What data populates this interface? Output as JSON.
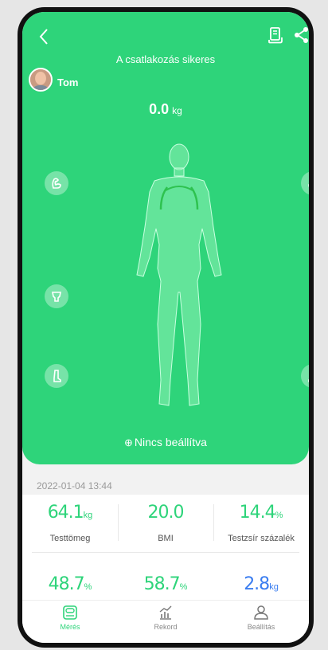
{
  "header": {
    "status": "A csatlakozás sikeres"
  },
  "user": {
    "name": "Tom"
  },
  "weight": {
    "value": "0.0",
    "unit": "kg"
  },
  "not_set_label": "Nincs beállítva",
  "date": "2022-01-04 13:44",
  "metrics": [
    {
      "value": "64.1",
      "unit": "kg",
      "label": "Testtömeg",
      "color": "#2ed47a"
    },
    {
      "value": "20.0",
      "unit": "",
      "label": "BMI",
      "color": "#2ed47a"
    },
    {
      "value": "14.4",
      "unit": "%",
      "label": "Testzsír százalék",
      "color": "#2ed47a"
    },
    {
      "value": "48.7",
      "unit": "%",
      "label": "",
      "color": "#2ed47a"
    },
    {
      "value": "58.7",
      "unit": "%",
      "label": "",
      "color": "#2ed47a"
    },
    {
      "value": "2.8",
      "unit": "kg",
      "label": "",
      "color": "#3a7df0"
    }
  ],
  "tabs": [
    {
      "label": "Mérés",
      "icon": "scale-icon",
      "active": true
    },
    {
      "label": "Rekord",
      "icon": "chart-icon",
      "active": false
    },
    {
      "label": "Beállítás",
      "icon": "person-icon",
      "active": false
    }
  ],
  "colors": {
    "accent": "#2ed47a",
    "blue_metric": "#3a7df0"
  }
}
